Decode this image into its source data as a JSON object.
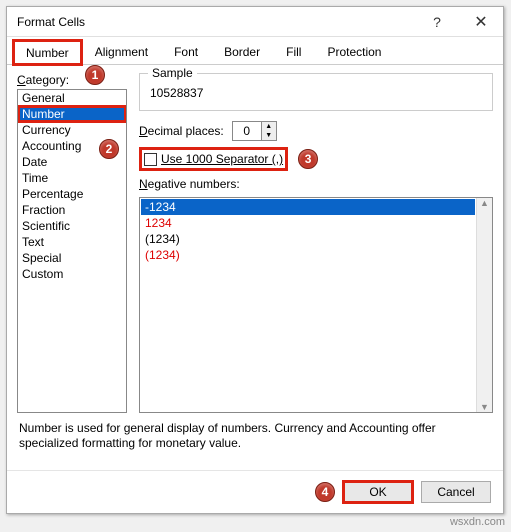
{
  "window": {
    "title": "Format Cells",
    "help_icon": "?",
    "close_icon": "✕"
  },
  "tabs": [
    {
      "label": "Number",
      "active": true
    },
    {
      "label": "Alignment",
      "active": false
    },
    {
      "label": "Font",
      "active": false
    },
    {
      "label": "Border",
      "active": false
    },
    {
      "label": "Fill",
      "active": false
    },
    {
      "label": "Protection",
      "active": false
    }
  ],
  "category": {
    "label": "Category:",
    "items": [
      {
        "label": "General",
        "selected": false
      },
      {
        "label": "Number",
        "selected": true
      },
      {
        "label": "Currency",
        "selected": false
      },
      {
        "label": "Accounting",
        "selected": false
      },
      {
        "label": "Date",
        "selected": false
      },
      {
        "label": "Time",
        "selected": false
      },
      {
        "label": "Percentage",
        "selected": false
      },
      {
        "label": "Fraction",
        "selected": false
      },
      {
        "label": "Scientific",
        "selected": false
      },
      {
        "label": "Text",
        "selected": false
      },
      {
        "label": "Special",
        "selected": false
      },
      {
        "label": "Custom",
        "selected": false
      }
    ]
  },
  "sample": {
    "label": "Sample",
    "value": "10528837"
  },
  "decimal": {
    "label": "Decimal places:",
    "value": "0"
  },
  "separator": {
    "label": "Use 1000 Separator (,)",
    "checked": false
  },
  "negative": {
    "label": "Negative numbers:",
    "items": [
      {
        "text": "-1234",
        "selected": true,
        "red": false
      },
      {
        "text": "1234",
        "selected": false,
        "red": true
      },
      {
        "text": "(1234)",
        "selected": false,
        "red": false
      },
      {
        "text": "(1234)",
        "selected": false,
        "red": true
      }
    ]
  },
  "description": "Number is used for general display of numbers.  Currency and Accounting offer specialized formatting for monetary value.",
  "buttons": {
    "ok": "OK",
    "cancel": "Cancel"
  },
  "callouts": {
    "c1": "1",
    "c2": "2",
    "c3": "3",
    "c4": "4"
  },
  "watermark": "wsxdn.com"
}
